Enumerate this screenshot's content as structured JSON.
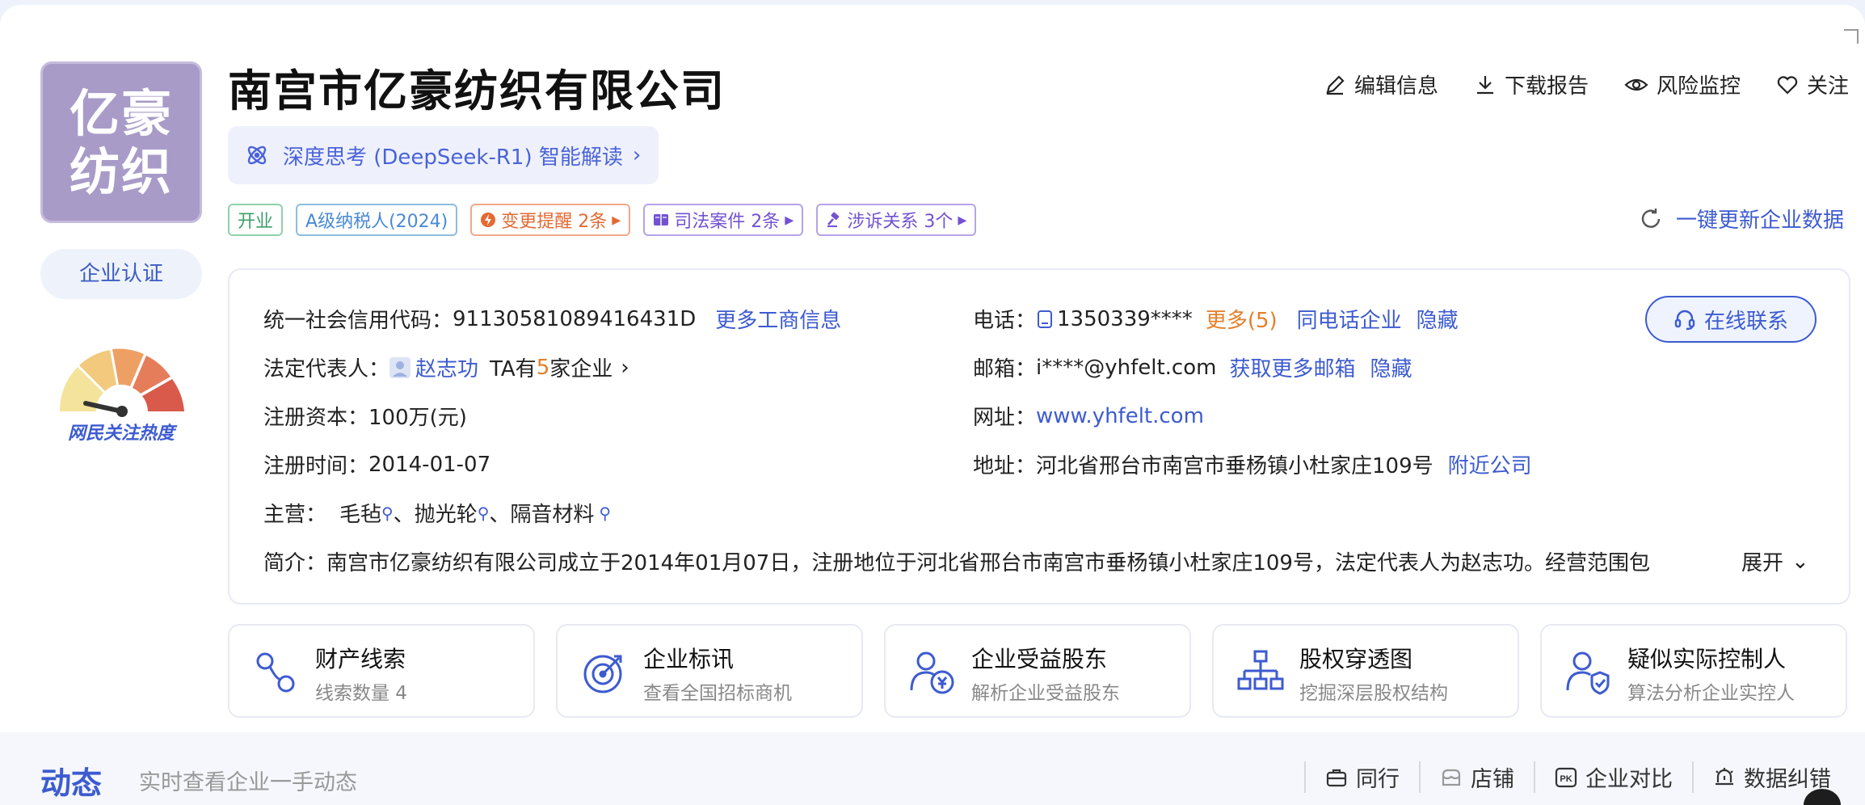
{
  "company": {
    "name": "南宫市亿豪纺织有限公司",
    "logo_line1": "亿豪",
    "logo_line2": "纺织",
    "certify_label": "企业认证",
    "popularity_label": "网民关注热度",
    "popularity_level": 0.15
  },
  "ai": {
    "label": "深度思考 (DeepSeek-R1) 智能解读"
  },
  "actions": [
    {
      "label": "编辑信息",
      "icon": "edit-icon"
    },
    {
      "label": "下载报告",
      "icon": "download-icon"
    },
    {
      "label": "风险监控",
      "icon": "eye-icon"
    },
    {
      "label": "关注",
      "icon": "heart-icon"
    }
  ],
  "tags": {
    "status": "开业",
    "tax": "A级纳税人(2024)",
    "change": "变更提醒 2条",
    "judicial": "司法案件 2条",
    "litigation": "涉诉关系 3个"
  },
  "update_label": "一键更新企业数据",
  "info": {
    "credit_label": "统一社会信用代码：",
    "credit_value": "91130581089416431D",
    "more_biz": "更多工商信息",
    "legal_label": "法定代表人：",
    "legal_name": "赵志功",
    "legal_ta1": "TA有",
    "legal_count": "5",
    "legal_ta2": "家企业",
    "capital_label": "注册资本：",
    "capital_value": "100万(元)",
    "date_label": "注册时间：",
    "date_value": "2014-01-07",
    "main_label": "主营：",
    "main_items": [
      "毛毡",
      "抛光轮",
      "隔音材料"
    ],
    "main_sep": "、",
    "intro_label": "简介：",
    "intro_text": "南宫市亿豪纺织有限公司成立于2014年01月07日，注册地位于河北省邢台市南宫市垂杨镇小杜家庄109号，法定代表人为赵志功。经营范围包",
    "expand": "展开",
    "phone_label": "电话：",
    "phone_value": "1350339****",
    "phone_more": "更多(5)",
    "same_phone": "同电话企业",
    "hide1": "隐藏",
    "email_label": "邮箱：",
    "email_value": "i****@yhfelt.com",
    "more_email": "获取更多邮箱",
    "hide2": "隐藏",
    "site_label": "网址：",
    "site_value": "www.yhfelt.com",
    "addr_label": "地址：",
    "addr_value": "河北省邢台市南宫市垂杨镇小杜家庄109号",
    "nearby": "附近公司",
    "contact_label": "在线联系"
  },
  "features": [
    {
      "title": "财产线索",
      "sub": "线索数量 4",
      "icon": "asset-clue-icon"
    },
    {
      "title": "企业标讯",
      "sub": "查看全国招标商机",
      "icon": "target-icon"
    },
    {
      "title": "企业受益股东",
      "sub": "解析企业受益股东",
      "icon": "beneficiary-icon"
    },
    {
      "title": "股权穿透图",
      "sub": "挖掘深层股权结构",
      "icon": "org-chart-icon"
    },
    {
      "title": "疑似实际控制人",
      "sub": "算法分析企业实控人",
      "icon": "controller-icon"
    }
  ],
  "bottom": {
    "title": "动态",
    "subtitle": "实时查看企业一手动态",
    "tools": [
      {
        "label": "同行",
        "icon": "briefcase-icon"
      },
      {
        "label": "店铺",
        "icon": "store-icon"
      },
      {
        "label": "企业对比",
        "icon": "pk-icon"
      },
      {
        "label": "数据纠错",
        "icon": "error-report-icon"
      }
    ]
  },
  "colors": {
    "accent": "#3d5bd0",
    "orange": "#e57f2a",
    "logo_bg": "#a89bc8"
  }
}
